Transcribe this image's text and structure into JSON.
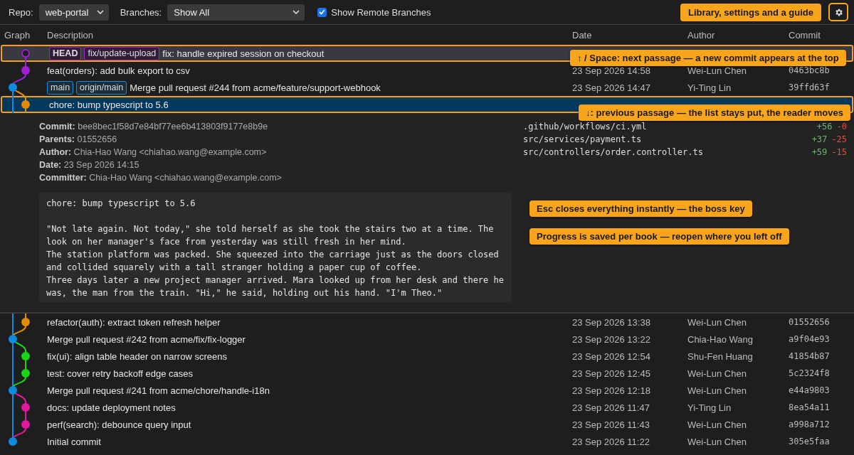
{
  "toolbar": {
    "repo": {
      "label": "Repo:",
      "value": "web-portal"
    },
    "branches": {
      "label": "Branches:",
      "value": "Show All"
    },
    "show_remote": {
      "label": "Show Remote Branches",
      "checked": true
    },
    "guide_button": "Library, settings and a guide"
  },
  "columns": [
    "Graph",
    "Description",
    "Date",
    "Author",
    "Commit"
  ],
  "commits": [
    {
      "kind": "branch",
      "color": "#a21fd8",
      "current": true,
      "selected": false,
      "highlighted": true,
      "refs": [
        {
          "label": "HEAD",
          "kind": "head",
          "color": "#a21fd8"
        },
        {
          "label": "fix/update-upload",
          "kind": "branch",
          "color": "#a21fd8"
        }
      ],
      "message": "fix: handle expired session on checkout"
    },
    {
      "kind": "branch",
      "color": "#a21fd8",
      "current": false,
      "selected": false,
      "highlighted": false,
      "message": "feat(orders): add bulk export to csv",
      "date": "23 Sep 2026 14:58",
      "author": "Wei-Lun Chen",
      "hash": "0463bc8b"
    },
    {
      "kind": "main",
      "color": "#0d8de0",
      "current": false,
      "selected": false,
      "highlighted": false,
      "refs": [
        {
          "label": "main",
          "kind": "branch",
          "color": "#0d8de0"
        },
        {
          "label": "origin/main",
          "kind": "remote",
          "color": "#0d8de0"
        }
      ],
      "message": "Merge pull request #244 from acme/feature/support-webhook",
      "date": "23 Sep 2026 14:47",
      "author": "Yi-Ting Lin",
      "hash": "39ffd63f"
    },
    {
      "kind": "branch",
      "color": "#e08c0b",
      "current": false,
      "selected": true,
      "highlighted": true,
      "message": "chore: bump typescript to 5.6",
      "details": {
        "fields": [
          {
            "label": "Commit:",
            "value": "bee8bec1f58d7e84bf77ee6b413803f9177e8b9e"
          },
          {
            "label": "Parents:",
            "value": "01552656"
          },
          {
            "label": "Author:",
            "value": "Chia-Hao Wang <chiahao.wang@example.com>"
          },
          {
            "label": "Date:",
            "value": "23 Sep 2026 14:15"
          },
          {
            "label": "Committer:",
            "value": "Chia-Hao Wang <chiahao.wang@example.com>"
          }
        ],
        "body": "chore: bump typescript to 5.6\n\n\"Not late again. Not today,\" she told herself as she took the stairs two at a time. The look on her manager's face from yesterday was still fresh in her mind.\nThe station platform was packed. She squeezed into the carriage just as the doors closed and collided squarely with a tall stranger holding a paper cup of coffee.\nThree days later a new project manager arrived. Mara looked up from her desk and there he was, the man from the train. \"Hi,\" he said, holding out his hand. \"I'm Theo.\"",
        "files": [
          {
            "path": ".github/workflows/ci.yml",
            "added": "+56",
            "removed": "-0"
          },
          {
            "path": "src/services/payment.ts",
            "added": "+37",
            "removed": "-25"
          },
          {
            "path": "src/controllers/order.controller.ts",
            "added": "+59",
            "removed": "-15"
          }
        ]
      }
    },
    {
      "kind": "branch",
      "color": "#e08c0b",
      "current": false,
      "selected": false,
      "highlighted": false,
      "message": "refactor(auth): extract token refresh helper",
      "date": "23 Sep 2026 13:38",
      "author": "Wei-Lun Chen",
      "hash": "01552656"
    },
    {
      "kind": "main",
      "color": "#0d8de0",
      "current": false,
      "selected": false,
      "highlighted": false,
      "message": "Merge pull request #242 from acme/fix/fix-logger",
      "date": "23 Sep 2026 13:22",
      "author": "Chia-Hao Wang",
      "hash": "a9f04e93"
    },
    {
      "kind": "branch",
      "color": "#17d417",
      "current": false,
      "selected": false,
      "highlighted": false,
      "message": "fix(ui): align table header on narrow screens",
      "date": "23 Sep 2026 12:54",
      "author": "Shu-Fen Huang",
      "hash": "41854b87"
    },
    {
      "kind": "branch",
      "color": "#17d417",
      "current": false,
      "selected": false,
      "highlighted": false,
      "message": "test: cover retry backoff edge cases",
      "date": "23 Sep 2026 12:45",
      "author": "Wei-Lun Chen",
      "hash": "5c2324f8"
    },
    {
      "kind": "main",
      "color": "#0d8de0",
      "current": false,
      "selected": false,
      "highlighted": false,
      "message": "Merge pull request #241 from acme/chore/handle-i18n",
      "date": "23 Sep 2026 12:18",
      "author": "Wei-Lun Chen",
      "hash": "e44a9803"
    },
    {
      "kind": "branch",
      "color": "#e0189f",
      "current": false,
      "selected": false,
      "highlighted": false,
      "message": "docs: update deployment notes",
      "date": "23 Sep 2026 11:47",
      "author": "Yi-Ting Lin",
      "hash": "8ea54a11"
    },
    {
      "kind": "branch",
      "color": "#e0189f",
      "current": false,
      "selected": false,
      "highlighted": false,
      "message": "perf(search): debounce query input",
      "date": "23 Sep 2026 11:43",
      "author": "Wei-Lun Chen",
      "hash": "a998a712"
    },
    {
      "kind": "main",
      "color": "#0d8de0",
      "current": false,
      "selected": false,
      "highlighted": false,
      "message": "Initial commit",
      "date": "23 Sep 2026 11:22",
      "author": "Wei-Lun Chen",
      "hash": "305e5faa"
    }
  ],
  "tips": [
    {
      "text": "↑ / Space: next passage — a new commit appears at the top"
    },
    {
      "text": "↓: previous passage — the list stays put, the reader moves"
    },
    {
      "text": "Esc closes everything instantly — the boss key"
    },
    {
      "text": "Progress is saved per book — reopen where you left off"
    }
  ]
}
